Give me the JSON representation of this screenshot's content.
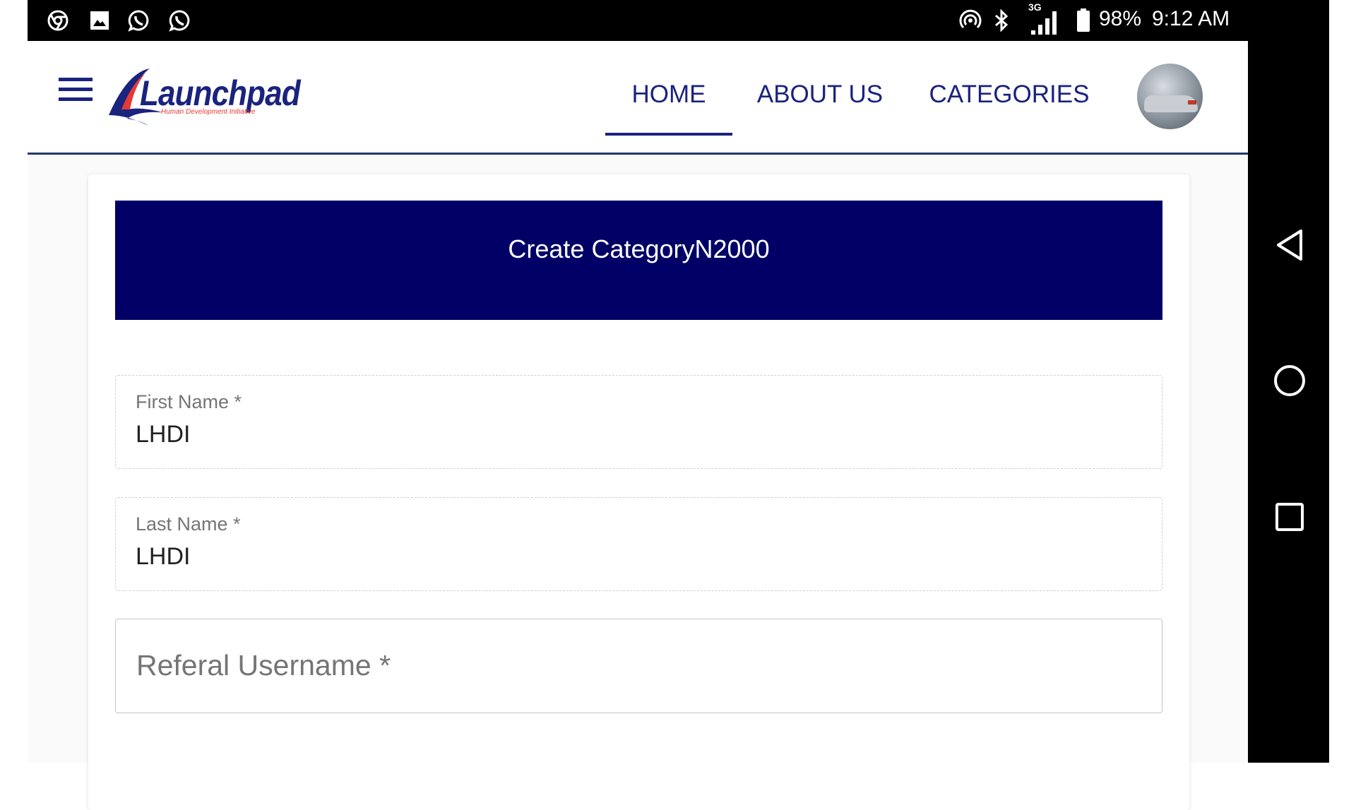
{
  "status_bar": {
    "left_icons": [
      "chrome-icon",
      "gallery-icon",
      "whatsapp-icon",
      "whatsapp-icon"
    ],
    "right_icons": [
      "hotspot-icon",
      "bluetooth-icon",
      "signal-3g-icon",
      "battery-icon"
    ],
    "network_type": "3G",
    "battery": "98%",
    "time": "9:12 AM"
  },
  "header": {
    "logo_text": "Launchpad",
    "logo_tagline": "Human Development Initiative",
    "nav": [
      {
        "label": "HOME",
        "active": true
      },
      {
        "label": "ABOUT US",
        "active": false
      },
      {
        "label": "CATEGORIES",
        "active": false
      }
    ]
  },
  "form": {
    "title": "Create CategoryN2000",
    "first_name": {
      "label": "First Name *",
      "value": "LHDI"
    },
    "last_name": {
      "label": "Last Name *",
      "value": "LHDI"
    },
    "referal_username": {
      "placeholder": "Referal Username *",
      "value": ""
    }
  },
  "colors": {
    "brand": "#000066",
    "nav_text": "#1a237e",
    "logo_red": "#e53935"
  }
}
